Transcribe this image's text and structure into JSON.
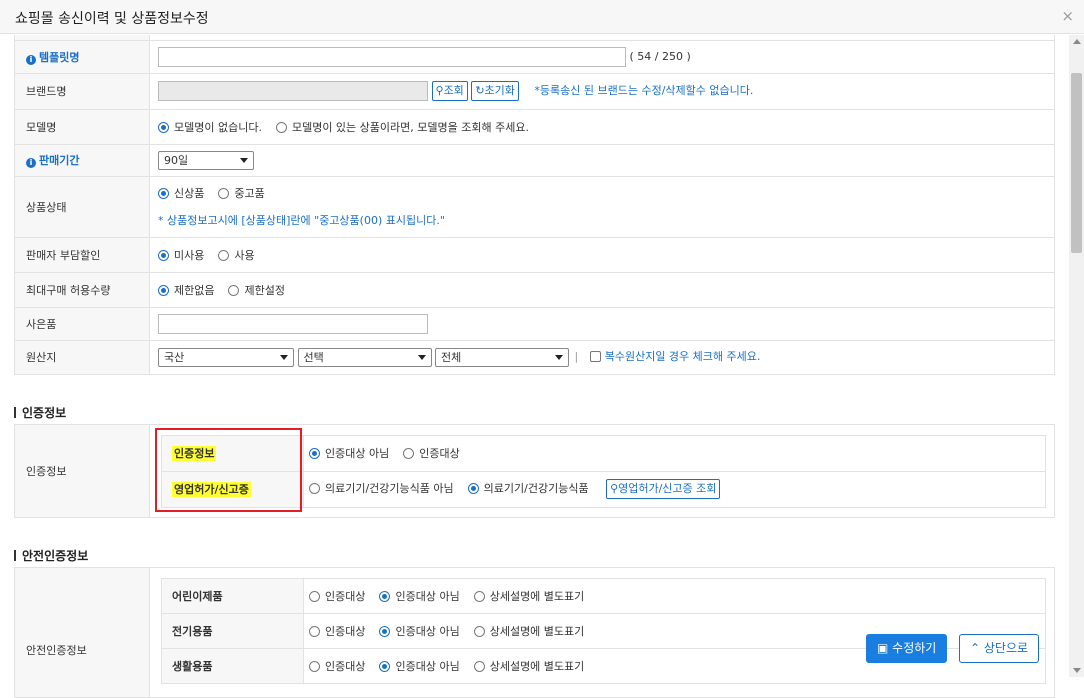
{
  "window": {
    "title": "쇼핑몰 송신이력 및 상품정보수정",
    "close": "×"
  },
  "form": {
    "template": {
      "label": "템플릿명",
      "counter": "( 54 / 250 )"
    },
    "brand": {
      "label": "브랜드명",
      "search": "조회",
      "reset": "초기화",
      "note": "*등록송신 된 브랜드는 수정/삭제할수 없습니다."
    },
    "model": {
      "label": "모델명",
      "opt1": "모델명이 없습니다.",
      "opt2": "모델명이 있는 상품이라면, 모델명을 조회해 주세요."
    },
    "period": {
      "label": "판매기간",
      "value": "90일"
    },
    "condition": {
      "label": "상품상태",
      "opt1": "신상품",
      "opt2": "중고품",
      "note": "* 상품정보고시에 [상품상태]란에 \"중고상품(00) 표시됩니다.\""
    },
    "discount": {
      "label": "판매자 부담할인",
      "opt1": "미사용",
      "opt2": "사용"
    },
    "maxqty": {
      "label": "최대구매 허용수량",
      "opt1": "제한없음",
      "opt2": "제한설정"
    },
    "gift": {
      "label": "사은품"
    },
    "origin": {
      "label": "원산지",
      "sel1": "국산",
      "sel2": "선택",
      "sel3": "전체",
      "sep": "|",
      "check": "복수원산지일 경우 체크해 주세요."
    }
  },
  "cert": {
    "section": "인증정보",
    "label": "인증정보",
    "row1": {
      "label": "인증정보",
      "opt1": "인증대상 아님",
      "opt2": "인증대상"
    },
    "row2": {
      "label": "영업허가/신고증",
      "opt1": "의료기기/건강기능식품 아님",
      "opt2": "의료기기/건강기능식품",
      "btn": "영업허가/신고증 조회"
    }
  },
  "safety": {
    "section": "안전인증정보",
    "label": "안전인증정보",
    "rows": [
      {
        "label": "어린이제품",
        "opt1": "인증대상",
        "opt2": "인증대상 아님",
        "opt3": "상세설명에 별도표기"
      },
      {
        "label": "전기용품",
        "opt1": "인증대상",
        "opt2": "인증대상 아님",
        "opt3": "상세설명에 별도표기"
      },
      {
        "label": "생활용품",
        "opt1": "인증대상",
        "opt2": "인증대상 아님",
        "opt3": "상세설명에 별도표기"
      }
    ]
  },
  "footer": {
    "save": "수정하기",
    "top": "상단으로"
  },
  "colors": {
    "accent": "#1a6fc6",
    "highlight": "#ffff33",
    "redbox": "#e31e24"
  }
}
